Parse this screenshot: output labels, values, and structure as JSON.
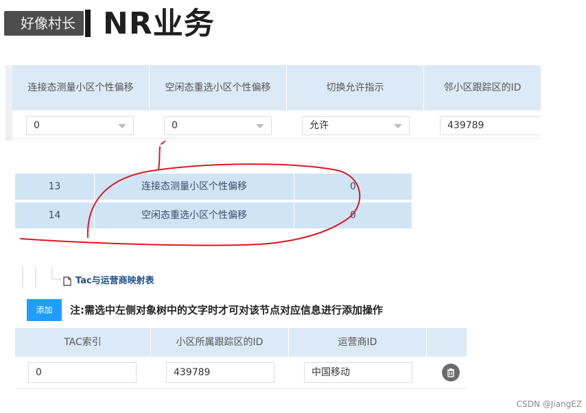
{
  "title": {
    "badge": "好像村长",
    "heading": "NR业务"
  },
  "top_table": {
    "headers": [
      "连接态测量小区个性偏移",
      "空闲态重选小区个性偏移",
      "切换允许指示",
      "邻小区跟踪区的ID"
    ],
    "row": {
      "conn_offset": "0",
      "idle_offset": "0",
      "handover_allowed": "允许",
      "neighbor_tac_id": "439789"
    }
  },
  "mid_table": {
    "rows": [
      {
        "index": "13",
        "name": "连接态测量小区个性偏移",
        "value": "0"
      },
      {
        "index": "14",
        "name": "空闲态重选小区个性偏移",
        "value": "0"
      }
    ]
  },
  "tree": {
    "item_label": "Tac与运营商映射表"
  },
  "actions": {
    "add_label": "添加",
    "note": "注:需选中左侧对象树中的文字时才可对该节点对应信息进行添加操作"
  },
  "bottom_table": {
    "headers": [
      "TAC索引",
      "小区所属跟踪区的ID",
      "运营商ID",
      ""
    ],
    "row": {
      "tac_index": "0",
      "tac_id": "439789",
      "operator_id": "中国移动"
    }
  },
  "watermark": "CSDN @JiangEZ",
  "colors": {
    "header_bg": "#dbeaf6",
    "highlight_row_bg": "#cfe5f6",
    "primary_button": "#1e9fff",
    "annotation_red": "#e0141e"
  },
  "icons": [
    "file-icon",
    "caret-down-icon",
    "trash-icon"
  ]
}
